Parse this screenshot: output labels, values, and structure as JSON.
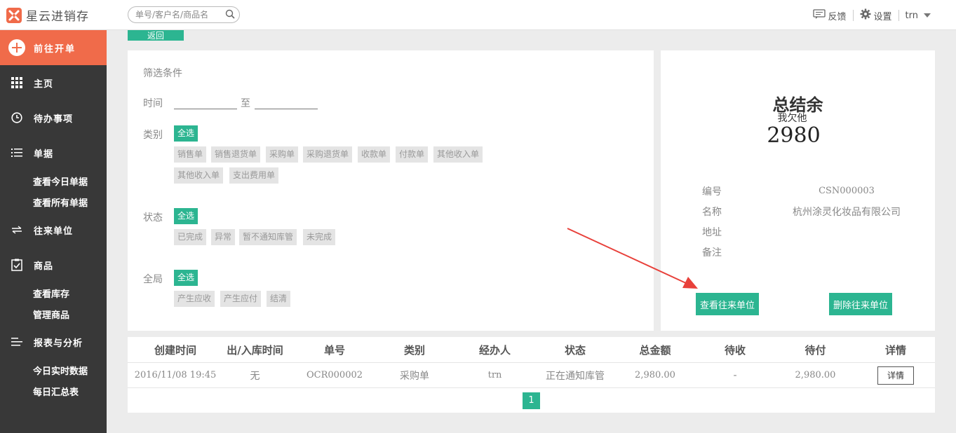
{
  "app": {
    "name": "星云进销存"
  },
  "search": {
    "placeholder": "单号/客户名/商品名"
  },
  "header": {
    "feedback": "反馈",
    "settings": "设置",
    "user": "trn"
  },
  "sidebar": {
    "new_order": "前往开单",
    "items": [
      {
        "label": "主页",
        "icon": "grid-icon"
      },
      {
        "label": "待办事项",
        "icon": "clock-icon"
      },
      {
        "label": "单据",
        "icon": "list-icon"
      },
      {
        "label": "查看今日单据"
      },
      {
        "label": "查看所有单据"
      },
      {
        "label": "往来单位",
        "icon": "exchange-icon"
      },
      {
        "label": "商品",
        "icon": "clipboard-check-icon"
      },
      {
        "label": "查看库存"
      },
      {
        "label": "管理商品"
      },
      {
        "label": "报表与分析",
        "icon": "bars-icon"
      },
      {
        "label": "今日实时数据"
      },
      {
        "label": "每日汇总表"
      }
    ]
  },
  "back_label": "返回",
  "filter": {
    "title": "筛选条件",
    "time_label": "时间",
    "to": "至",
    "category_label": "类别",
    "status_label": "状态",
    "global_label": "全局",
    "select_all": "全选",
    "categories": [
      "销售单",
      "销售退货单",
      "采购单",
      "采购退货单",
      "收款单",
      "付款单",
      "其他收入单",
      "其他收入单",
      "支出费用单"
    ],
    "statuses": [
      "已完成",
      "异常",
      "暂不通知库管",
      "未完成"
    ],
    "globals": [
      "产生应收",
      "产生应付",
      "结清"
    ]
  },
  "summary": {
    "title": "总结余",
    "subtitle": "我欠他",
    "amount": "2980",
    "labels": {
      "code": "编号",
      "name": "名称",
      "address": "地址",
      "remark": "备注"
    },
    "values": {
      "code": "CSN000003",
      "name": "杭州涂灵化妆品有限公司",
      "address": "",
      "remark": ""
    },
    "view_button": "查看往来单位",
    "delete_button": "删除往来单位"
  },
  "table": {
    "headers": [
      "创建时间",
      "出/入库时间",
      "单号",
      "类别",
      "经办人",
      "状态",
      "总金额",
      "待收",
      "待付",
      "详情"
    ],
    "rows": [
      [
        "2016/11/08 19:45",
        "无",
        "OCR000002",
        "采购单",
        "trn",
        "正在通知库管",
        "2,980.00",
        "-",
        "2,980.00",
        "详情"
      ]
    ]
  },
  "pagination": {
    "current": "1"
  },
  "colors": {
    "accent": "#2cb591",
    "brand": "#f06b4a",
    "sidebar": "#383838",
    "arrow": "#e8403a"
  }
}
